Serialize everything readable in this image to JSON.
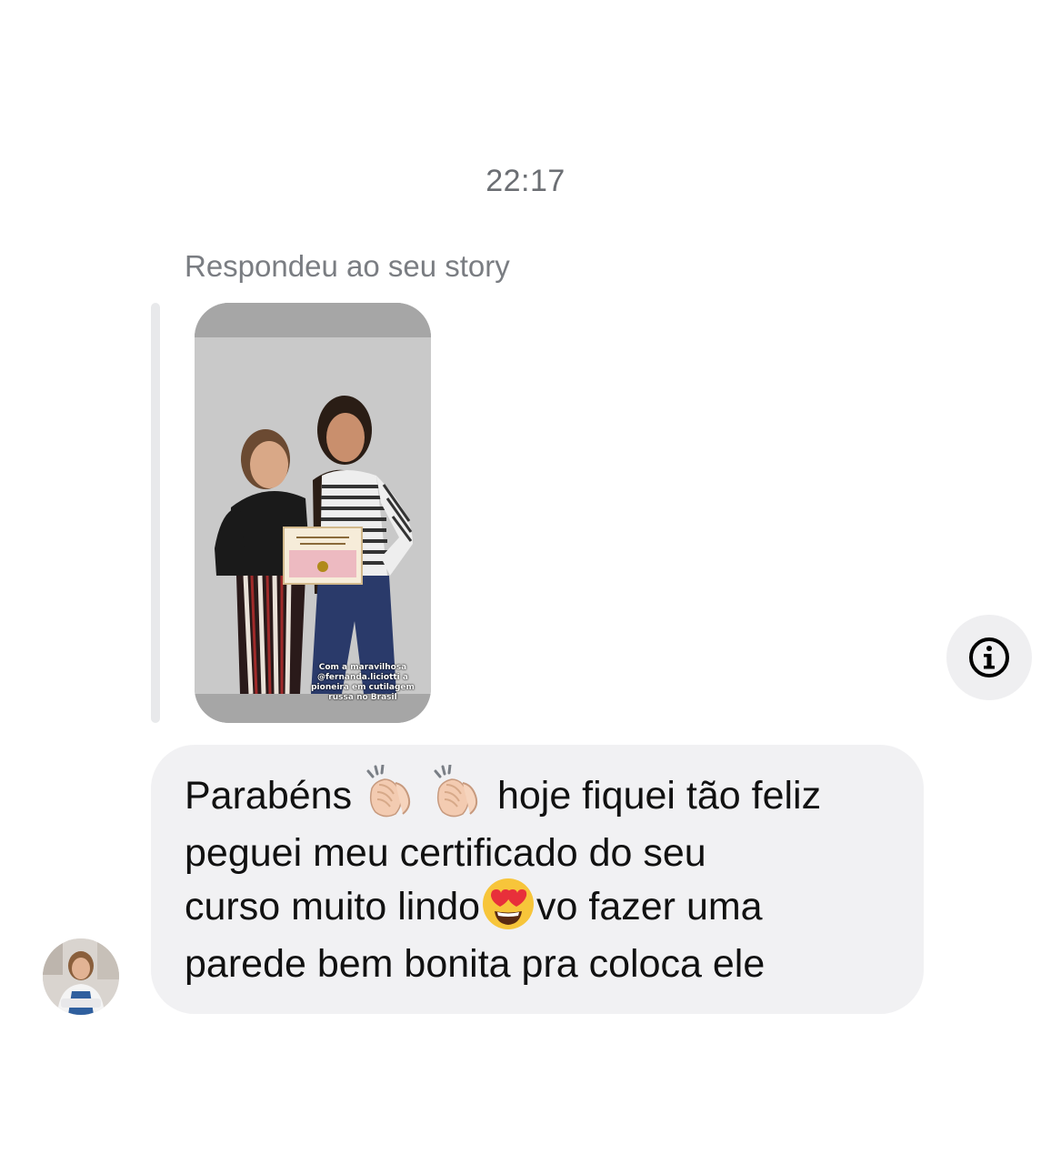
{
  "conversation": {
    "timestamp": "22:17",
    "reply_label": "Respondeu ao seu story"
  },
  "story": {
    "caption": "Com a maravilhosa\n@fernanda.liciotti a\npioneira em cutilagem\nrussa no Brasil"
  },
  "message": {
    "line1_before": "Parabéns ",
    "line1_after": " hoje fiquei tão feliz",
    "line2": "peguei meu certificado do seu",
    "line3_before": "curso muito lindo",
    "line3_after": "vo fazer uma",
    "line4": "parede bem bonita pra coloca ele",
    "emojis": [
      "clapping-hands",
      "clapping-hands",
      "smiling-face-with-heart-eyes"
    ]
  },
  "icons": {
    "info": "info-icon"
  },
  "colors": {
    "bubble_background": "#f1f1f3",
    "timestamp_text": "#6b6e73",
    "reply_bar": "#e8e9eb"
  }
}
